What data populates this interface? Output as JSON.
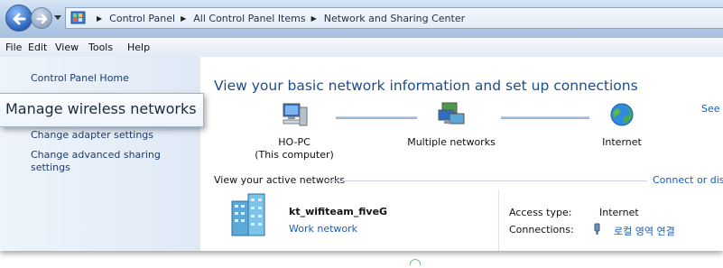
{
  "breadcrumbs": [
    "Control Panel",
    "All Control Panel Items",
    "Network and Sharing Center"
  ],
  "menu": [
    "File",
    "Edit",
    "View",
    "Tools",
    "Help"
  ],
  "sidebar": {
    "items": [
      {
        "label": "Control Panel Home"
      },
      {
        "label": "Change adapter settings"
      },
      {
        "label": "Change advanced sharing settings"
      }
    ],
    "zoom_callout": "Manage wireless networks"
  },
  "main": {
    "heading": "View your basic network information and set up connections",
    "see_link": "See",
    "map": {
      "computer_name": "HO-PC",
      "computer_sub": "(This computer)",
      "middle": "Multiple networks",
      "internet": "Internet"
    },
    "active_label": "View your active networks",
    "connect_link": "Connect or dis",
    "network": {
      "name": "kt_wifiteam_fiveG",
      "type": "Work network",
      "access_label": "Access type:",
      "access_value": "Internet",
      "connections_label": "Connections:",
      "connection_name": "로컬 영역 연결"
    }
  },
  "colors": {
    "link": "#1a5db3",
    "heading": "#1e4b8c",
    "sidebar_bg": "#dfe9f6"
  }
}
